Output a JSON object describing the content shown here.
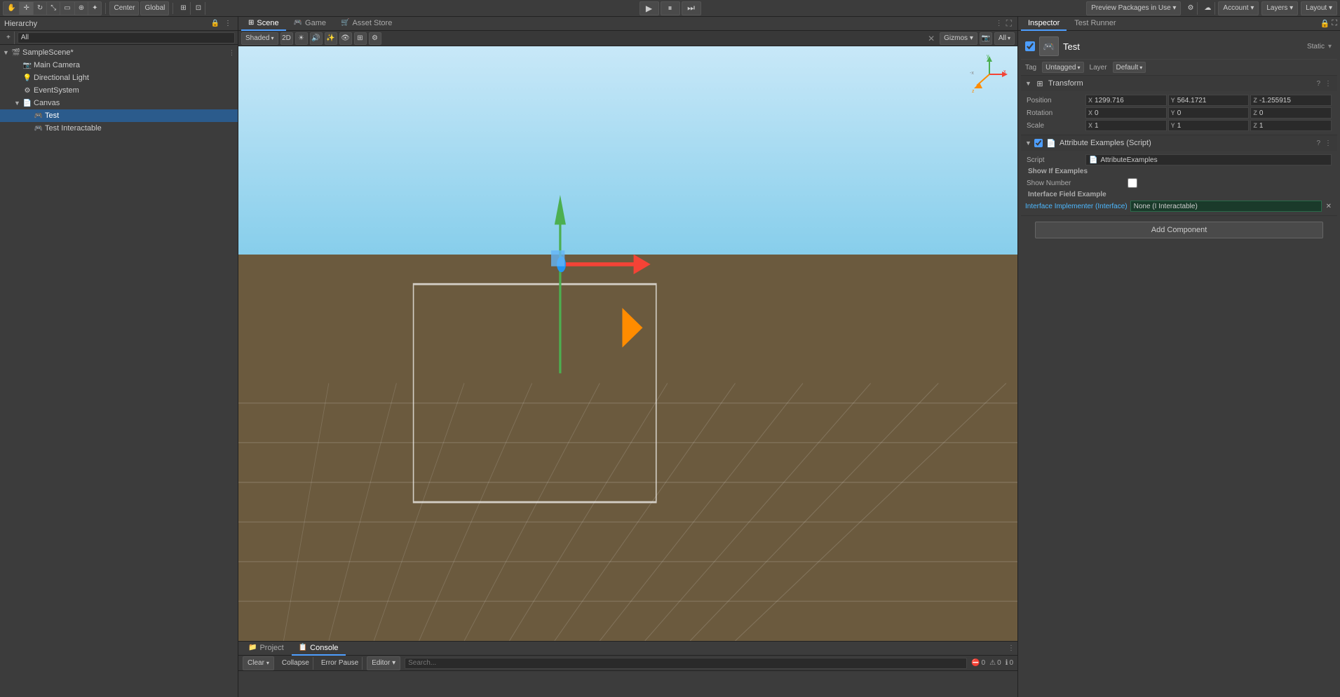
{
  "topbar": {
    "play_label": "▶",
    "pause_label": "⏸",
    "step_label": "⏭",
    "preview_packages": "Preview Packages in Use ▾",
    "collab_icon": "☁",
    "account": "Account ▾",
    "layers": "Layers ▾",
    "layout": "Layout ▾",
    "tools": [
      "hand",
      "move",
      "rotate",
      "scale",
      "rect",
      "all",
      "custom"
    ],
    "center_label": "Center",
    "global_label": "Global"
  },
  "hierarchy": {
    "title": "Hierarchy",
    "search_placeholder": "All",
    "items": [
      {
        "id": "samplescene",
        "label": "SampleScene*",
        "indent": 0,
        "expanded": true,
        "icon": "🎬",
        "has_arrow": true,
        "options": true
      },
      {
        "id": "maincamera",
        "label": "Main Camera",
        "indent": 1,
        "icon": "📷",
        "has_arrow": false
      },
      {
        "id": "dirlight",
        "label": "Directional Light",
        "indent": 1,
        "icon": "💡",
        "has_arrow": false
      },
      {
        "id": "eventsystem",
        "label": "EventSystem",
        "indent": 1,
        "icon": "⚙",
        "has_arrow": false
      },
      {
        "id": "canvas",
        "label": "Canvas",
        "indent": 1,
        "icon": "📄",
        "has_arrow": true,
        "expanded": true
      },
      {
        "id": "test",
        "label": "Test",
        "indent": 2,
        "icon": "🎮",
        "has_arrow": false,
        "selected": true
      },
      {
        "id": "testinteractable",
        "label": "Test Interactable",
        "indent": 2,
        "icon": "🎮",
        "has_arrow": false
      }
    ]
  },
  "viewport": {
    "tabs": [
      {
        "id": "scene",
        "label": "Scene",
        "icon": "⊞",
        "active": true
      },
      {
        "id": "game",
        "label": "Game",
        "icon": "🎮",
        "active": false
      },
      {
        "id": "asset_store",
        "label": "Asset Store",
        "icon": "🛒",
        "active": false
      }
    ],
    "shade_dropdown": "Shaded",
    "mode_2d": "2D",
    "gizmos": "Gizmos ▾",
    "search_all": "All"
  },
  "console": {
    "tabs": [
      {
        "id": "project",
        "label": "Project",
        "icon": "📁",
        "active": false
      },
      {
        "id": "console",
        "label": "Console",
        "icon": "📋",
        "active": true
      }
    ],
    "clear_label": "Clear",
    "collapse_label": "Collapse",
    "error_pause_label": "Error Pause",
    "editor_label": "Editor ▾",
    "counts": {
      "errors": "0",
      "warnings": "0",
      "messages": "0"
    }
  },
  "inspector": {
    "title": "Inspector",
    "tab_test_runner": "Test Runner",
    "game_object": {
      "name": "Test",
      "tag_label": "Tag",
      "tag_value": "Untagged",
      "layer_label": "Layer",
      "layer_value": "Default",
      "static_label": "Static"
    },
    "transform": {
      "title": "Transform",
      "position_label": "Position",
      "pos_x": "1299.716",
      "pos_y": "564.1721",
      "pos_z": "-1.255915",
      "rotation_label": "Rotation",
      "rot_x": "0",
      "rot_y": "0",
      "rot_z": "0",
      "scale_label": "Scale",
      "scale_x": "1",
      "scale_y": "1",
      "scale_z": "1"
    },
    "attribute_examples": {
      "title": "Attribute Examples (Script)",
      "script_label": "Script",
      "script_value": "AttributeExamples",
      "section_show_if": "Show If Examples",
      "show_number_label": "Show Number",
      "section_interface": "Interface Field Example",
      "interface_label": "Interface Implementer (Interface)",
      "interface_value": "None (I Interactable)"
    },
    "add_component_label": "Add Component"
  }
}
